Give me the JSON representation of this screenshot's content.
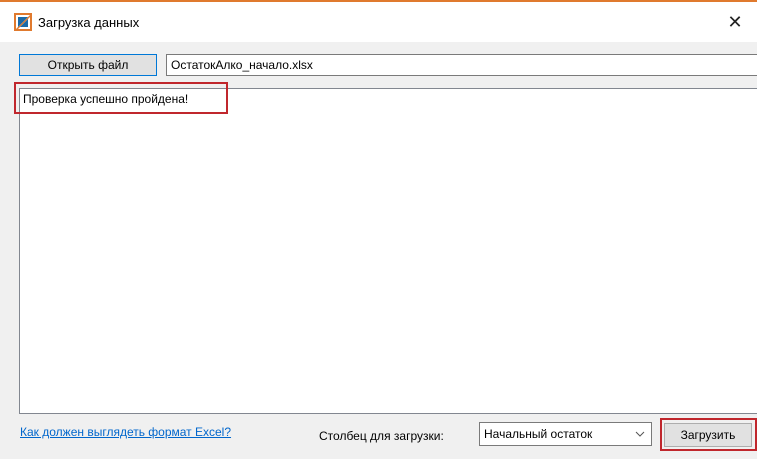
{
  "window": {
    "title": "Загрузка данных",
    "close_glyph": "✕",
    "accent_color": "#e07a2e",
    "icon": "app-logo-icon"
  },
  "toolbar": {
    "open_button_label": "Открыть файл",
    "file_name": "ОстатокАлко_начало.xlsx"
  },
  "log": {
    "message": "Проверка успешно пройдена!"
  },
  "footer": {
    "help_link": "Как должен выглядеть формат Excel?",
    "column_label": "Столбец для загрузки:",
    "column_selected": "Начальный остаток",
    "load_button_label": "Загрузить"
  },
  "annotations": {
    "highlight_color": "#c0272d"
  }
}
